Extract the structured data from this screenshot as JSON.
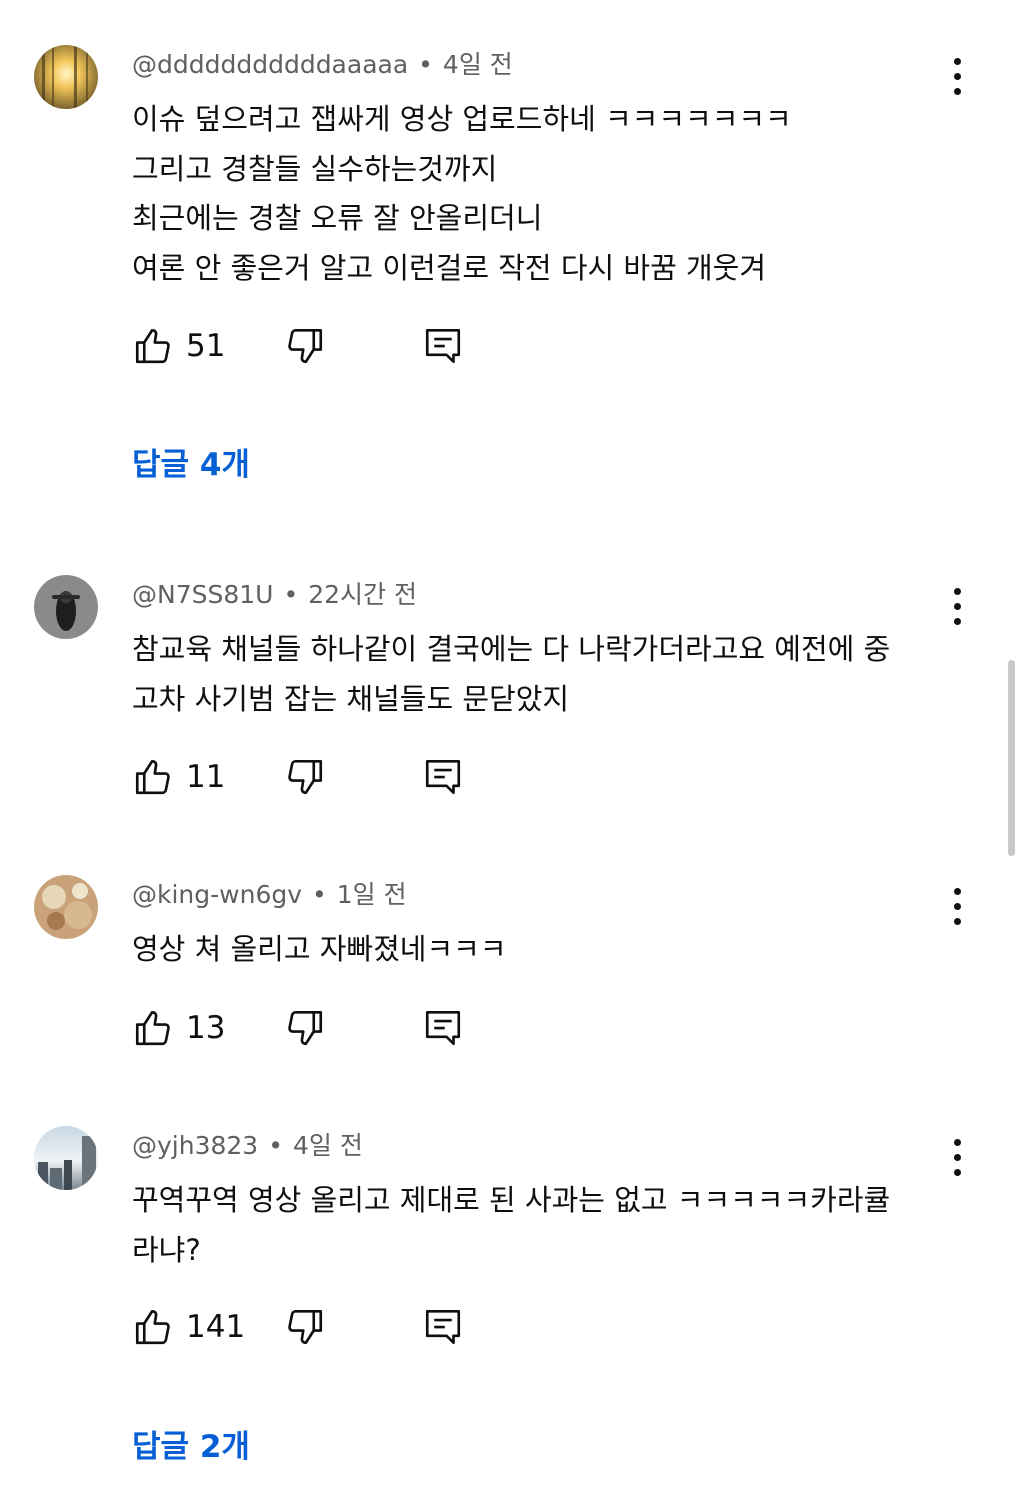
{
  "comments": [
    {
      "handle": "@dddddddddddaaaaa",
      "time": "4일 전",
      "lines": [
        "이슈 덮으려고 잽싸게 영상 업로드하네 ㅋㅋㅋㅋㅋㅋㅋ",
        "그리고 경찰들 실수하는것까지",
        "최근에는 경찰 오류 잘 안올리더니",
        "여론 안 좋은거 알고 이런걸로 작전 다시 바꿈 개웃겨"
      ],
      "likes": "51",
      "replies_label": "답글 4개"
    },
    {
      "handle": "@N7SS81U",
      "time": "22시간 전",
      "lines": [
        "참교육 채널들 하나같이 결국에는 다 나락가더라고요 예전에 중",
        "고차 사기범 잡는 채널들도 문닫았지"
      ],
      "likes": "11"
    },
    {
      "handle": "@king-wn6gv",
      "time": "1일 전",
      "lines": [
        "영상 쳐 올리고 자빠졌네ㅋㅋㅋ"
      ],
      "likes": "13"
    },
    {
      "handle": "@yjh3823",
      "time": "4일 전",
      "lines": [
        "꾸역꾸역 영상 올리고 제대로 된 사과는 없고 ㅋㅋㅋㅋㅋ카라큘",
        "라냐?"
      ],
      "likes": "141",
      "replies_label": "답글 2개"
    }
  ],
  "meta_separator": "•",
  "icons": {
    "like": "thumbs-up-icon",
    "dislike": "thumbs-down-icon",
    "reply": "comment-reply-icon",
    "more": "more-vertical-icon"
  },
  "colors": {
    "text": "#0f0f0f",
    "meta": "#606060",
    "link": "#065fd4"
  }
}
